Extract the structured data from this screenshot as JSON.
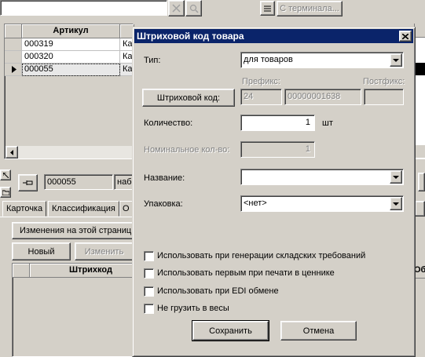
{
  "toolbar": {
    "search_value": "",
    "terminal_button": "С терминала..."
  },
  "grid": {
    "column_header": "Артикул",
    "rows": [
      {
        "article": "000319",
        "name": "Ка"
      },
      {
        "article": "000320",
        "name": "Ка"
      },
      {
        "article": "000055",
        "name": "Ка"
      }
    ]
  },
  "detail": {
    "article_value": "000055",
    "name_value": "набо",
    "tabs": [
      "Карточка",
      "Классификация",
      "О"
    ],
    "changes_label": "Изменения на этой страниц",
    "new_button": "Новый",
    "edit_button": "Изменить",
    "barcode_header": "Штрихкод",
    "right_header": "Об"
  },
  "dialog": {
    "title": "Штриховой код товара",
    "type_label": "Тип:",
    "type_value": "для товаров",
    "prefix_label": "Префикс:",
    "postfix_label": "Постфикс:",
    "barcode_button": "Штриховой код:",
    "prefix_value": "24",
    "code_value": "00000001638",
    "postfix_value": "",
    "quantity_label": "Количество:",
    "quantity_value": "1",
    "quantity_unit": "шт",
    "nominal_label": "Номинальное кол-во:",
    "nominal_value": "1",
    "name_label": "Название:",
    "name_value": "",
    "packaging_label": "Упаковка:",
    "packaging_value": "<нет>",
    "checkboxes": [
      {
        "label": "Использовать при генерации складских требований",
        "checked": false
      },
      {
        "label": "Использовать первым при печати в ценнике",
        "checked": false
      },
      {
        "label": "Использовать при EDI обмене",
        "checked": false
      },
      {
        "label": "Не грузить в весы",
        "checked": false
      }
    ],
    "save_button": "Сохранить",
    "cancel_button": "Отмена"
  }
}
